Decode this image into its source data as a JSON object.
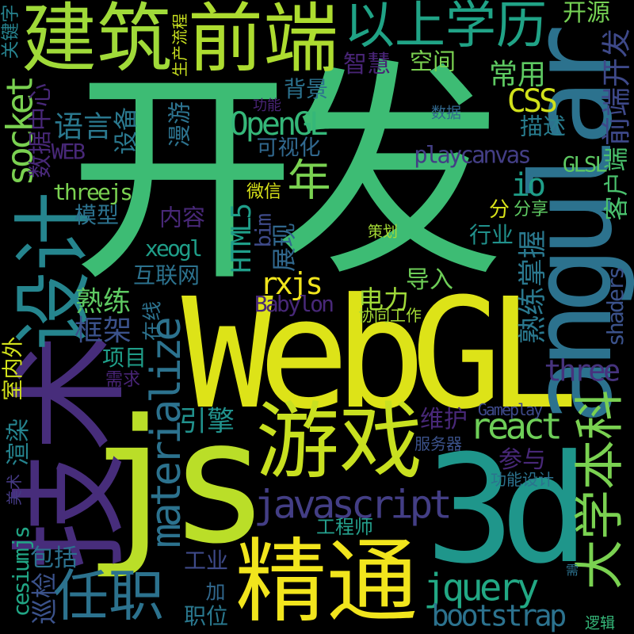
{
  "background": "#000000",
  "words": [
    {
      "text": "开",
      "color": "#3dbc74"
    },
    {
      "text": "发",
      "color": "#3dbc74"
    },
    {
      "text": "WebGL",
      "color": "#dde318"
    },
    {
      "text": "js",
      "color": "#bade28"
    },
    {
      "text": "3d",
      "color": "#1f968b"
    },
    {
      "text": "angular",
      "color": "#2c728e"
    },
    {
      "text": "技术",
      "color": "#472d7b"
    },
    {
      "text": "设计",
      "color": "#25858e"
    },
    {
      "text": "建筑",
      "color": "#a0da39"
    },
    {
      "text": "前端",
      "color": "#addc30"
    },
    {
      "text": "以上学历",
      "color": "#20a386"
    },
    {
      "text": "开源",
      "color": "#75d054"
    },
    {
      "text": "前端开发",
      "color": "#3e4989"
    },
    {
      "text": "客户端",
      "color": "#4ac16d"
    },
    {
      "text": "智慧",
      "color": "#482475"
    },
    {
      "text": "空间",
      "color": "#7ad151"
    },
    {
      "text": "常用",
      "color": "#5ec962"
    },
    {
      "text": "CSS",
      "color": "#d2e21b"
    },
    {
      "text": "数据",
      "color": "#31688e"
    },
    {
      "text": "描述",
      "color": "#287c8e"
    },
    {
      "text": "playcanvas",
      "color": "#433e85"
    },
    {
      "text": "GLSL",
      "color": "#5ec962"
    },
    {
      "text": "io",
      "color": "#1f9e89"
    },
    {
      "text": "分",
      "color": "#d8e219"
    },
    {
      "text": "分享",
      "color": "#5ec962"
    },
    {
      "text": "策划",
      "color": "#a5db36"
    },
    {
      "text": "行业",
      "color": "#21918c"
    },
    {
      "text": "熟练掌握",
      "color": "#2a788e"
    },
    {
      "text": "导入",
      "color": "#6ece58"
    },
    {
      "text": "电力",
      "color": "#a0da39"
    },
    {
      "text": "协同工作",
      "color": "#a5db36"
    },
    {
      "text": "shaders",
      "color": "#3b528b"
    },
    {
      "text": "three",
      "color": "#46337e"
    },
    {
      "text": "大学本科",
      "color": "#7ad151"
    },
    {
      "text": "维护",
      "color": "#482878"
    },
    {
      "text": "react",
      "color": "#6ece58"
    },
    {
      "text": "Gameplay",
      "color": "#3e4989"
    },
    {
      "text": "服务器",
      "color": "#3b528b"
    },
    {
      "text": "参与",
      "color": "#482878"
    },
    {
      "text": "功能设计",
      "color": "#2c728e"
    },
    {
      "text": "javascript",
      "color": "#433e85"
    },
    {
      "text": "工程师",
      "color": "#25a18e"
    },
    {
      "text": "jquery",
      "color": "#22a884"
    },
    {
      "text": "bootstrap",
      "color": "#2c728e"
    },
    {
      "text": "需",
      "color": "#2c728e"
    },
    {
      "text": "逻辑",
      "color": "#35b779"
    },
    {
      "text": "精通",
      "color": "#f1e51d"
    },
    {
      "text": "游戏",
      "color": "#c8e020"
    },
    {
      "text": "任职",
      "color": "#2c728e"
    },
    {
      "text": "materialize",
      "color": "#2c728e"
    },
    {
      "text": "框架",
      "color": "#3b528b"
    },
    {
      "text": "在线",
      "color": "#2c728e"
    },
    {
      "text": "项目",
      "color": "#1f9e89"
    },
    {
      "text": "需求",
      "color": "#482475"
    },
    {
      "text": "室内外",
      "color": "#d2e21b"
    },
    {
      "text": "渲染",
      "color": "#25838e"
    },
    {
      "text": "美术",
      "color": "#443983"
    },
    {
      "text": "cesiumjs",
      "color": "#21a685"
    },
    {
      "text": "包括",
      "color": "#2c728e"
    },
    {
      "text": "巡检",
      "color": "#3b528b"
    },
    {
      "text": "引擎",
      "color": "#21918c"
    },
    {
      "text": "工业",
      "color": "#3e4a89"
    },
    {
      "text": "加",
      "color": "#31688e"
    },
    {
      "text": "职位",
      "color": "#2a788e"
    },
    {
      "text": "关键字",
      "color": "#26828e"
    },
    {
      "text": "生产流程",
      "color": "#c8e020"
    },
    {
      "text": "socket",
      "color": "#7ad151"
    },
    {
      "text": "数据中心",
      "color": "#482878"
    },
    {
      "text": "语言",
      "color": "#2a788e"
    },
    {
      "text": "设备",
      "color": "#2a788e"
    },
    {
      "text": "WEB",
      "color": "#482878"
    },
    {
      "text": "漫游",
      "color": "#2c728e"
    },
    {
      "text": "功能",
      "color": "#482475"
    },
    {
      "text": "背景",
      "color": "#2c728e"
    },
    {
      "text": "OpenGL",
      "color": "#35b779"
    },
    {
      "text": "可视化",
      "color": "#31688e"
    },
    {
      "text": "threejs",
      "color": "#7ad151"
    },
    {
      "text": "模型",
      "color": "#2c728e"
    },
    {
      "text": "内容",
      "color": "#482878"
    },
    {
      "text": "微信",
      "color": "#d8e219"
    },
    {
      "text": "年",
      "color": "#7ad151"
    },
    {
      "text": "HTML5",
      "color": "#1f9e89"
    },
    {
      "text": "bim",
      "color": "#3e4a89"
    },
    {
      "text": "展现",
      "color": "#31688e"
    },
    {
      "text": "xeogl",
      "color": "#1f9e89"
    },
    {
      "text": "互联网",
      "color": "#2c728e"
    },
    {
      "text": "rxjs",
      "color": "#f1e51d"
    },
    {
      "text": "熟练",
      "color": "#5ec962"
    },
    {
      "text": "Babylon",
      "color": "#482878"
    }
  ]
}
